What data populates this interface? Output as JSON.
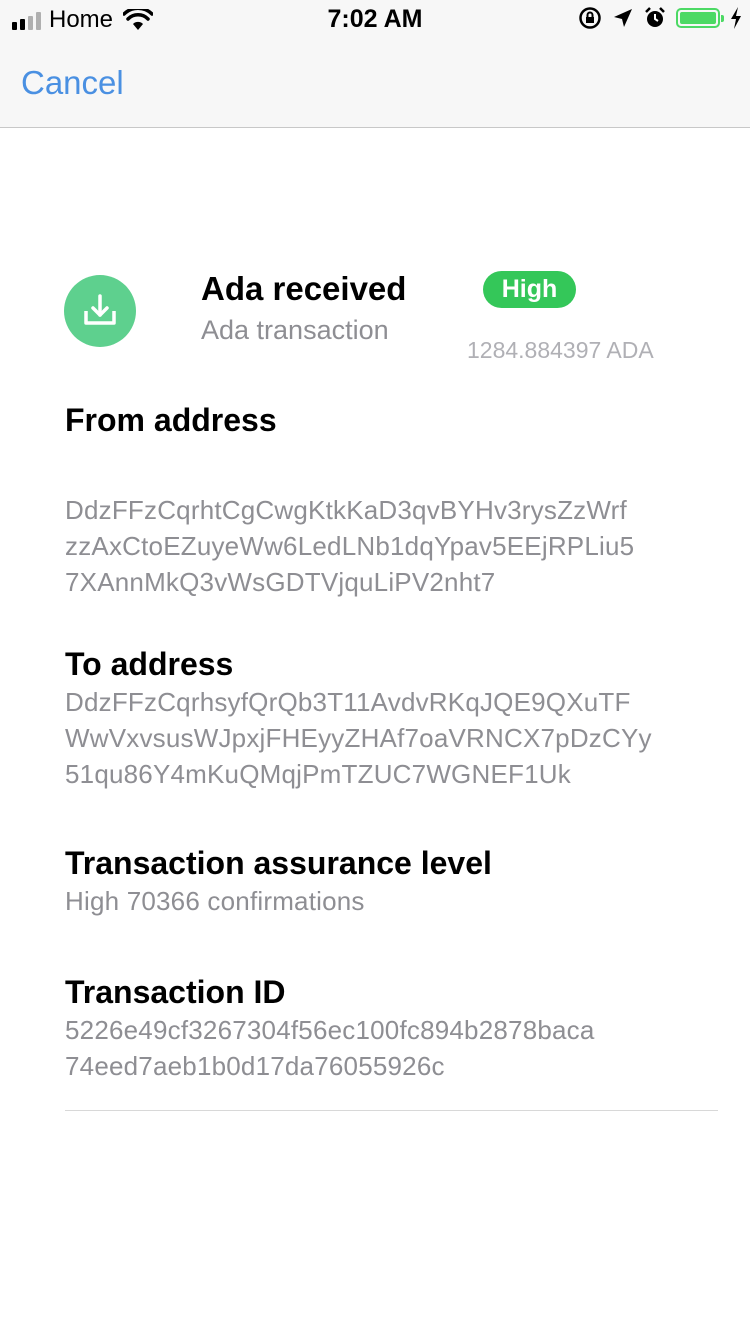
{
  "status_bar": {
    "carrier": "Home",
    "time": "7:02 AM",
    "battery_color": "#4cd964"
  },
  "nav": {
    "cancel_label": "Cancel"
  },
  "transaction": {
    "icon": "download-icon",
    "title": "Ada received",
    "subtitle": "Ada transaction",
    "badge": "High",
    "badge_color": "#34c759",
    "amount": "1284.884397 ADA"
  },
  "sections": {
    "from": {
      "label": "From address",
      "lines": [
        "DdzFFzCqrhtCgCwgKtkKaD3qvBYHv3rysZzWrf",
        "zzAxCtoEZuyeWw6LedLNb1dqYpav5EEjRPLiu5",
        "7XAnnMkQ3vWsGDTVjquLiPV2nht7"
      ]
    },
    "to": {
      "label": "To address",
      "lines": [
        "DdzFFzCqrhsyfQrQb3T11AvdvRKqJQE9QXuTF",
        "WwVxvsusWJpxjFHEyyZHAf7oaVRNCX7pDzCYy",
        "51qu86Y4mKuQMqjPmTZUC7WGNEF1Uk"
      ]
    },
    "assurance": {
      "label": "Transaction assurance level",
      "value": "High 70366 confirmations"
    },
    "tx_id": {
      "label": "Transaction ID",
      "lines": [
        "5226e49cf3267304f56ec100fc894b2878baca",
        "74eed7aeb1b0d17da76055926c"
      ]
    }
  }
}
